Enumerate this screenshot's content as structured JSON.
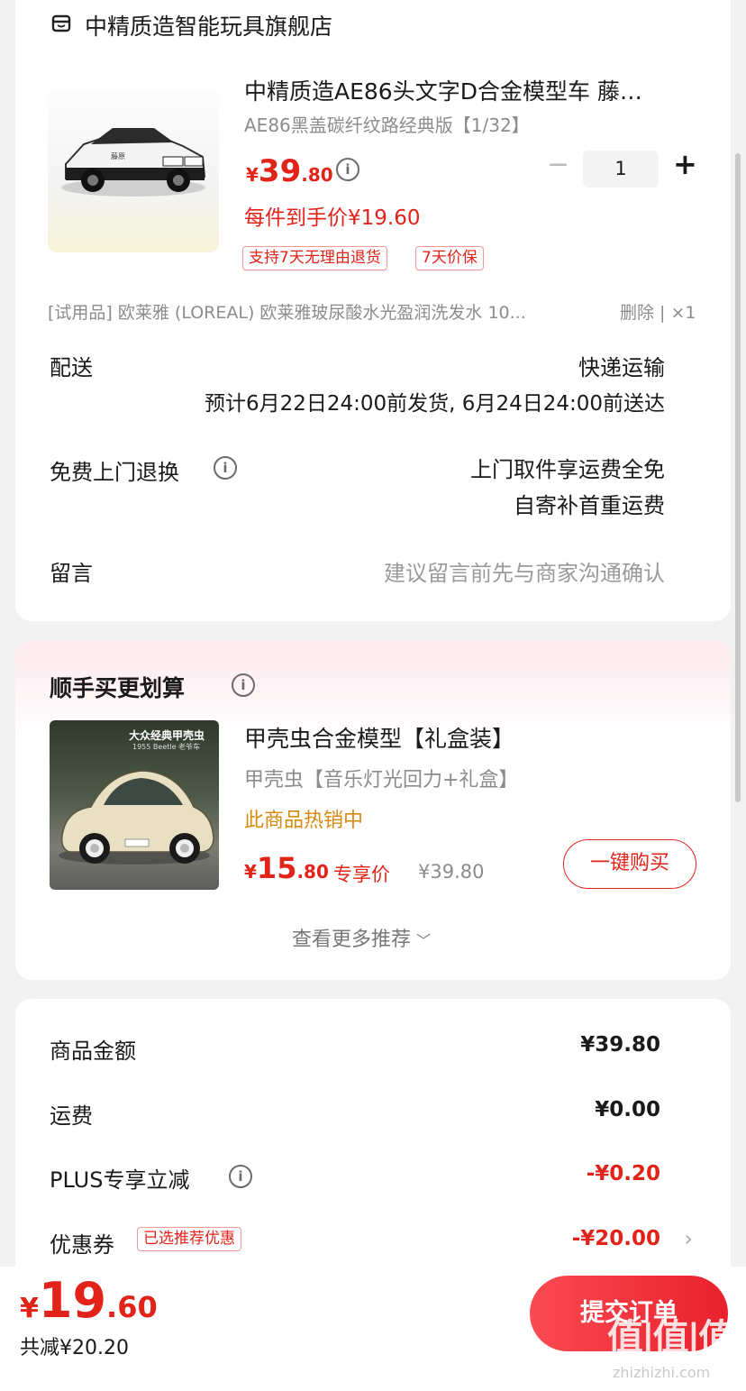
{
  "store": {
    "name": "中精质造智能玩具旗舰店"
  },
  "product": {
    "title": "中精质造AE86头文字D合金模型车 藤…",
    "spec": "AE86黑盖碳纤纹路经典版【1/32】",
    "price_symbol": "¥",
    "price_int": "39",
    "price_dec": ".80",
    "final_price_label": "每件到手价¥19.60",
    "quantity": "1",
    "tags": [
      "支持7天无理由退货",
      "7天价保"
    ]
  },
  "trial_item": {
    "text": "[试用品] 欧莱雅 (LOREAL) 欧莱雅玻尿酸水光盈润洗发水 10...",
    "action": "删除 | ×1"
  },
  "delivery": {
    "label": "配送",
    "method": "快递运输",
    "estimate": "预计6月22日24:00前发货, 6月24日24:00前送达"
  },
  "returns": {
    "label": "免费上门退换",
    "line1": "上门取件享运费全免",
    "line2": "自寄补首重运费"
  },
  "message": {
    "label": "留言",
    "placeholder": "建议留言前先与商家沟通确认"
  },
  "recommend": {
    "section_title": "顺手买更划算",
    "img_title": "大众经典甲壳虫",
    "img_subtitle": "1955 Beetle 老爷车",
    "title": "甲壳虫合金模型【礼盒装】",
    "spec": "甲壳虫【音乐灯光回力+礼盒】",
    "hot": "此商品热销中",
    "price_symbol": "¥",
    "price_int": "15",
    "price_dec": ".80",
    "price_label": "专享价",
    "orig_price": "¥39.80",
    "buy_button": "一键购买",
    "more": "查看更多推荐"
  },
  "summary": {
    "rows": [
      {
        "label": "商品金额",
        "value": "¥39.80"
      },
      {
        "label": "运费",
        "value": "¥0.00"
      },
      {
        "label": "PLUS专享立减",
        "value": "-¥0.20"
      },
      {
        "label": "优惠券",
        "value": "-¥20.00",
        "tag": "已选推荐优惠"
      }
    ]
  },
  "footer": {
    "total_symbol": "¥",
    "total_int": "19",
    "total_dec": ".60",
    "saved": "共减¥20.20",
    "submit": "提交订单",
    "watermark": "值|值|值",
    "watermark_url": "zhizhizhi.com"
  },
  "colors": {
    "accent": "#e2231a",
    "button_gradient_start": "#fb4a52",
    "button_gradient_end": "#e8212c"
  }
}
